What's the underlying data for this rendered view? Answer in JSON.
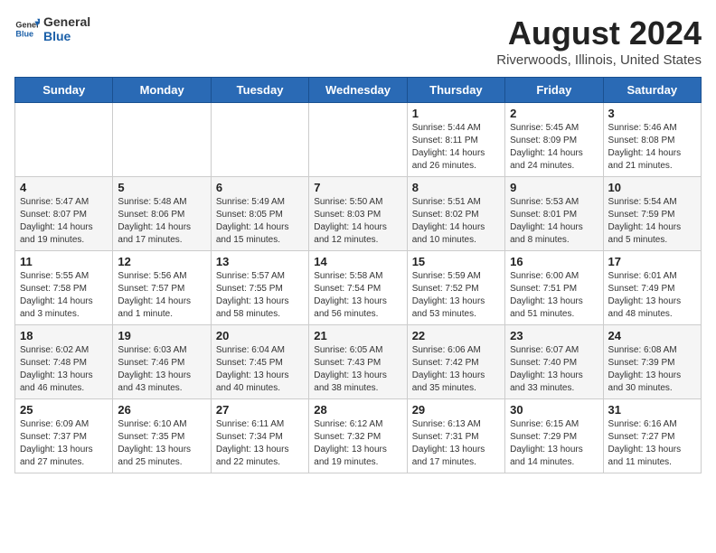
{
  "header": {
    "logo_general": "General",
    "logo_blue": "Blue",
    "month_title": "August 2024",
    "location": "Riverwoods, Illinois, United States"
  },
  "calendar": {
    "days_of_week": [
      "Sunday",
      "Monday",
      "Tuesday",
      "Wednesday",
      "Thursday",
      "Friday",
      "Saturday"
    ],
    "weeks": [
      [
        {
          "day": "",
          "info": ""
        },
        {
          "day": "",
          "info": ""
        },
        {
          "day": "",
          "info": ""
        },
        {
          "day": "",
          "info": ""
        },
        {
          "day": "1",
          "info": "Sunrise: 5:44 AM\nSunset: 8:11 PM\nDaylight: 14 hours and 26 minutes."
        },
        {
          "day": "2",
          "info": "Sunrise: 5:45 AM\nSunset: 8:09 PM\nDaylight: 14 hours and 24 minutes."
        },
        {
          "day": "3",
          "info": "Sunrise: 5:46 AM\nSunset: 8:08 PM\nDaylight: 14 hours and 21 minutes."
        }
      ],
      [
        {
          "day": "4",
          "info": "Sunrise: 5:47 AM\nSunset: 8:07 PM\nDaylight: 14 hours and 19 minutes."
        },
        {
          "day": "5",
          "info": "Sunrise: 5:48 AM\nSunset: 8:06 PM\nDaylight: 14 hours and 17 minutes."
        },
        {
          "day": "6",
          "info": "Sunrise: 5:49 AM\nSunset: 8:05 PM\nDaylight: 14 hours and 15 minutes."
        },
        {
          "day": "7",
          "info": "Sunrise: 5:50 AM\nSunset: 8:03 PM\nDaylight: 14 hours and 12 minutes."
        },
        {
          "day": "8",
          "info": "Sunrise: 5:51 AM\nSunset: 8:02 PM\nDaylight: 14 hours and 10 minutes."
        },
        {
          "day": "9",
          "info": "Sunrise: 5:53 AM\nSunset: 8:01 PM\nDaylight: 14 hours and 8 minutes."
        },
        {
          "day": "10",
          "info": "Sunrise: 5:54 AM\nSunset: 7:59 PM\nDaylight: 14 hours and 5 minutes."
        }
      ],
      [
        {
          "day": "11",
          "info": "Sunrise: 5:55 AM\nSunset: 7:58 PM\nDaylight: 14 hours and 3 minutes."
        },
        {
          "day": "12",
          "info": "Sunrise: 5:56 AM\nSunset: 7:57 PM\nDaylight: 14 hours and 1 minute."
        },
        {
          "day": "13",
          "info": "Sunrise: 5:57 AM\nSunset: 7:55 PM\nDaylight: 13 hours and 58 minutes."
        },
        {
          "day": "14",
          "info": "Sunrise: 5:58 AM\nSunset: 7:54 PM\nDaylight: 13 hours and 56 minutes."
        },
        {
          "day": "15",
          "info": "Sunrise: 5:59 AM\nSunset: 7:52 PM\nDaylight: 13 hours and 53 minutes."
        },
        {
          "day": "16",
          "info": "Sunrise: 6:00 AM\nSunset: 7:51 PM\nDaylight: 13 hours and 51 minutes."
        },
        {
          "day": "17",
          "info": "Sunrise: 6:01 AM\nSunset: 7:49 PM\nDaylight: 13 hours and 48 minutes."
        }
      ],
      [
        {
          "day": "18",
          "info": "Sunrise: 6:02 AM\nSunset: 7:48 PM\nDaylight: 13 hours and 46 minutes."
        },
        {
          "day": "19",
          "info": "Sunrise: 6:03 AM\nSunset: 7:46 PM\nDaylight: 13 hours and 43 minutes."
        },
        {
          "day": "20",
          "info": "Sunrise: 6:04 AM\nSunset: 7:45 PM\nDaylight: 13 hours and 40 minutes."
        },
        {
          "day": "21",
          "info": "Sunrise: 6:05 AM\nSunset: 7:43 PM\nDaylight: 13 hours and 38 minutes."
        },
        {
          "day": "22",
          "info": "Sunrise: 6:06 AM\nSunset: 7:42 PM\nDaylight: 13 hours and 35 minutes."
        },
        {
          "day": "23",
          "info": "Sunrise: 6:07 AM\nSunset: 7:40 PM\nDaylight: 13 hours and 33 minutes."
        },
        {
          "day": "24",
          "info": "Sunrise: 6:08 AM\nSunset: 7:39 PM\nDaylight: 13 hours and 30 minutes."
        }
      ],
      [
        {
          "day": "25",
          "info": "Sunrise: 6:09 AM\nSunset: 7:37 PM\nDaylight: 13 hours and 27 minutes."
        },
        {
          "day": "26",
          "info": "Sunrise: 6:10 AM\nSunset: 7:35 PM\nDaylight: 13 hours and 25 minutes."
        },
        {
          "day": "27",
          "info": "Sunrise: 6:11 AM\nSunset: 7:34 PM\nDaylight: 13 hours and 22 minutes."
        },
        {
          "day": "28",
          "info": "Sunrise: 6:12 AM\nSunset: 7:32 PM\nDaylight: 13 hours and 19 minutes."
        },
        {
          "day": "29",
          "info": "Sunrise: 6:13 AM\nSunset: 7:31 PM\nDaylight: 13 hours and 17 minutes."
        },
        {
          "day": "30",
          "info": "Sunrise: 6:15 AM\nSunset: 7:29 PM\nDaylight: 13 hours and 14 minutes."
        },
        {
          "day": "31",
          "info": "Sunrise: 6:16 AM\nSunset: 7:27 PM\nDaylight: 13 hours and 11 minutes."
        }
      ]
    ]
  }
}
